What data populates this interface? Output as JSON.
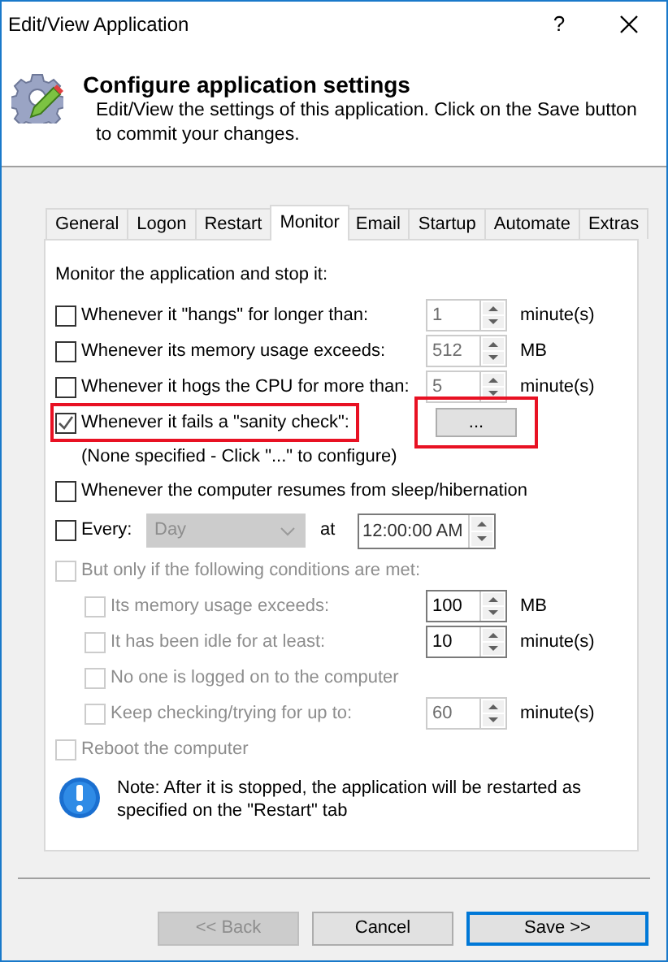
{
  "window": {
    "title": "Edit/View Application",
    "help": "?"
  },
  "header": {
    "title": "Configure application settings",
    "subtitle": "Edit/View the settings of this application. Click on the Save button to commit your changes."
  },
  "tabs": [
    {
      "label": "General",
      "selected": false
    },
    {
      "label": "Logon",
      "selected": false
    },
    {
      "label": "Restart",
      "selected": false
    },
    {
      "label": "Monitor",
      "selected": true
    },
    {
      "label": "Email",
      "selected": false
    },
    {
      "label": "Startup",
      "selected": false
    },
    {
      "label": "Automate",
      "selected": false
    },
    {
      "label": "Extras",
      "selected": false
    }
  ],
  "monitor": {
    "heading": "Monitor the application and stop it:",
    "options": [
      {
        "kind": "spin",
        "label": "Whenever it \"hangs\" for longer than:",
        "checked": false,
        "disabled": false,
        "highlighted": false,
        "value": "1",
        "value_disabled": true,
        "unit": "minute(s)"
      },
      {
        "kind": "spin",
        "label": "Whenever its memory usage exceeds:",
        "checked": false,
        "disabled": false,
        "highlighted": false,
        "value": "512",
        "value_disabled": true,
        "unit": "MB"
      },
      {
        "kind": "spin",
        "label": "Whenever it hogs the CPU for more than:",
        "checked": false,
        "disabled": false,
        "highlighted": false,
        "value": "5",
        "value_disabled": true,
        "unit": "minute(s)"
      },
      {
        "kind": "button",
        "label": "Whenever it fails a \"sanity check\":",
        "checked": true,
        "disabled": false,
        "highlighted": true,
        "button": "...",
        "button_highlighted": true,
        "hint": "(None specified - Click \"...\" to configure)"
      },
      {
        "kind": "plain",
        "label": "Whenever the computer resumes from sleep/hibernation",
        "checked": false,
        "disabled": false,
        "highlighted": false
      },
      {
        "kind": "schedule",
        "label": "Every:",
        "checked": false,
        "disabled": false,
        "highlighted": false,
        "period": "Day",
        "at": "at",
        "time": "12:00:00 AM"
      },
      {
        "kind": "plain",
        "label": "But only if the following conditions are met:",
        "checked": false,
        "disabled": true,
        "highlighted": false,
        "children": [
          {
            "kind": "spin",
            "label": "Its memory usage exceeds:",
            "checked": false,
            "disabled": true,
            "highlighted": false,
            "value": "100",
            "value_disabled": false,
            "unit": "MB"
          },
          {
            "kind": "spin",
            "label": "It has been idle for at least:",
            "checked": false,
            "disabled": true,
            "highlighted": false,
            "value": "10",
            "value_disabled": false,
            "unit": "minute(s)"
          },
          {
            "kind": "plain",
            "label": "No one is logged on to the computer",
            "checked": false,
            "disabled": true,
            "highlighted": false
          },
          {
            "kind": "spin",
            "label": "Keep checking/trying for up to:",
            "checked": false,
            "disabled": true,
            "highlighted": false,
            "value": "60",
            "value_disabled": true,
            "unit": "minute(s)"
          }
        ]
      },
      {
        "kind": "plain",
        "label": "Reboot the computer",
        "checked": false,
        "disabled": true,
        "highlighted": false
      }
    ],
    "note": "Note: After it is stopped, the application will be restarted as specified on the \"Restart\" tab"
  },
  "buttons": [
    {
      "label": "<< Back",
      "disabled": true,
      "default": false
    },
    {
      "label": "Cancel",
      "disabled": false,
      "default": false
    },
    {
      "label": "Save >>",
      "disabled": false,
      "default": true
    }
  ]
}
